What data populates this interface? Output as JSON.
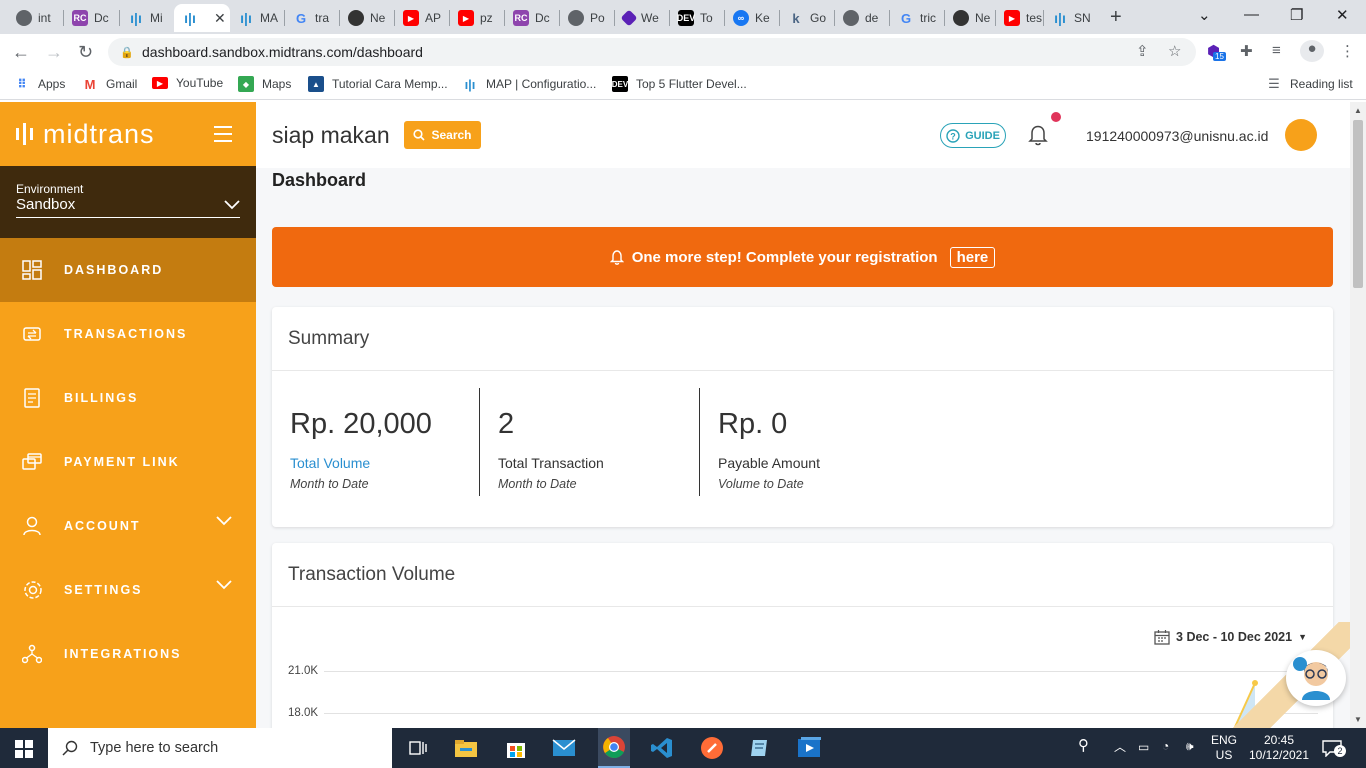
{
  "browser": {
    "tabs": [
      {
        "label": "int",
        "icon": "chrome-icon",
        "color": "#5f6368"
      },
      {
        "label": "Dc",
        "icon": "rc-icon",
        "color": "#8e44ad"
      },
      {
        "label": "Mi",
        "icon": "midtrans-icon",
        "color": "#2a8fd0"
      },
      {
        "label": "",
        "icon": "midtrans-icon",
        "color": "#2a8fd0"
      },
      {
        "label": "MA",
        "icon": "midtrans-icon",
        "color": "#2a8fd0"
      },
      {
        "label": "tra",
        "icon": "google-icon",
        "color": "#4285f4"
      },
      {
        "label": "Ne",
        "icon": "github-icon",
        "color": "#333333"
      },
      {
        "label": "AP",
        "icon": "youtube-icon",
        "color": "#ff0000"
      },
      {
        "label": "pz",
        "icon": "youtube-icon",
        "color": "#ff0000"
      },
      {
        "label": "Dc",
        "icon": "rc-icon",
        "color": "#8e44ad"
      },
      {
        "label": "Po",
        "icon": "chrome-icon",
        "color": "#5f6368"
      },
      {
        "label": "We",
        "icon": "hexagon-icon",
        "color": "#5b21b6"
      },
      {
        "label": "To",
        "icon": "dev-icon",
        "color": "#000000"
      },
      {
        "label": "Ke",
        "icon": "meta-icon",
        "color": "#1877f2"
      },
      {
        "label": "Go",
        "icon": "k-icon",
        "color": "#4b6584"
      },
      {
        "label": "de",
        "icon": "chrome-icon",
        "color": "#5f6368"
      },
      {
        "label": "tric",
        "icon": "google-icon",
        "color": "#4285f4"
      },
      {
        "label": "Ne",
        "icon": "github-icon",
        "color": "#333333"
      },
      {
        "label": "tes",
        "icon": "youtube-icon",
        "color": "#ff0000"
      },
      {
        "label": "SN",
        "icon": "midtrans-icon",
        "color": "#2a8fd0"
      }
    ],
    "url": "dashboard.sandbox.midtrans.com/dashboard",
    "extension_badge": "15",
    "bookmarks": [
      {
        "label": "Apps",
        "icon": "apps-grid-icon",
        "color": "#4285f4"
      },
      {
        "label": "Gmail",
        "icon": "gmail-icon",
        "color": "#ea4335"
      },
      {
        "label": "YouTube",
        "icon": "youtube-icon",
        "color": "#ff0000"
      },
      {
        "label": "Maps",
        "icon": "maps-icon",
        "color": "#34a853"
      },
      {
        "label": "Tutorial Cara Memp...",
        "icon": "bookmark-site-icon",
        "color": "#1a4f8b"
      },
      {
        "label": "MAP | Configuratio...",
        "icon": "midtrans-icon",
        "color": "#2a8fd0"
      },
      {
        "label": "Top 5 Flutter Devel...",
        "icon": "dev-icon",
        "color": "#000000"
      }
    ],
    "reading_list": "Reading list"
  },
  "sidebar": {
    "logo": "midtrans",
    "environment_label": "Environment",
    "environment_value": "Sandbox",
    "items": [
      {
        "label": "DASHBOARD",
        "icon": "dashboard-icon",
        "active": true
      },
      {
        "label": "TRANSACTIONS",
        "icon": "transactions-icon"
      },
      {
        "label": "BILLINGS",
        "icon": "billings-icon"
      },
      {
        "label": "PAYMENT LINK",
        "icon": "payment-link-icon"
      },
      {
        "label": "ACCOUNT",
        "icon": "account-icon",
        "expandable": true
      },
      {
        "label": "SETTINGS",
        "icon": "settings-icon",
        "expandable": true
      },
      {
        "label": "INTEGRATIONS",
        "icon": "integrations-icon"
      }
    ]
  },
  "header": {
    "merchant": "siap makan",
    "search_label": "Search",
    "guide_label": "GUIDE",
    "email": "191240000973@unisnu.ac.id"
  },
  "page": {
    "title": "Dashboard",
    "banner_text": "One more step! Complete your registration",
    "banner_link": "here"
  },
  "summary": {
    "title": "Summary",
    "stats": [
      {
        "value": "Rp. 20,000",
        "label": "Total Volume",
        "sub": "Month to Date"
      },
      {
        "value": "2",
        "label": "Total Transaction",
        "sub": "Month to Date"
      },
      {
        "value": "Rp. 0",
        "label": "Payable Amount",
        "sub": "Volume to Date"
      }
    ]
  },
  "volume": {
    "title": "Transaction Volume",
    "date_range": "3 Dec - 10 Dec 2021",
    "y_ticks": [
      "21.0K",
      "18.0K"
    ]
  },
  "taskbar": {
    "search_placeholder": "Type here to search",
    "lang_top": "ENG",
    "lang_bottom": "US",
    "time": "20:45",
    "date": "10/12/2021",
    "notif_count": "2"
  },
  "colors": {
    "sidebar": "#f7a11a",
    "sidebar_active": "#c47c10",
    "environment_bg": "#3f2a0d",
    "banner": "#f0690f",
    "link": "#2a8fd0",
    "guide": "#2aa3b8"
  }
}
